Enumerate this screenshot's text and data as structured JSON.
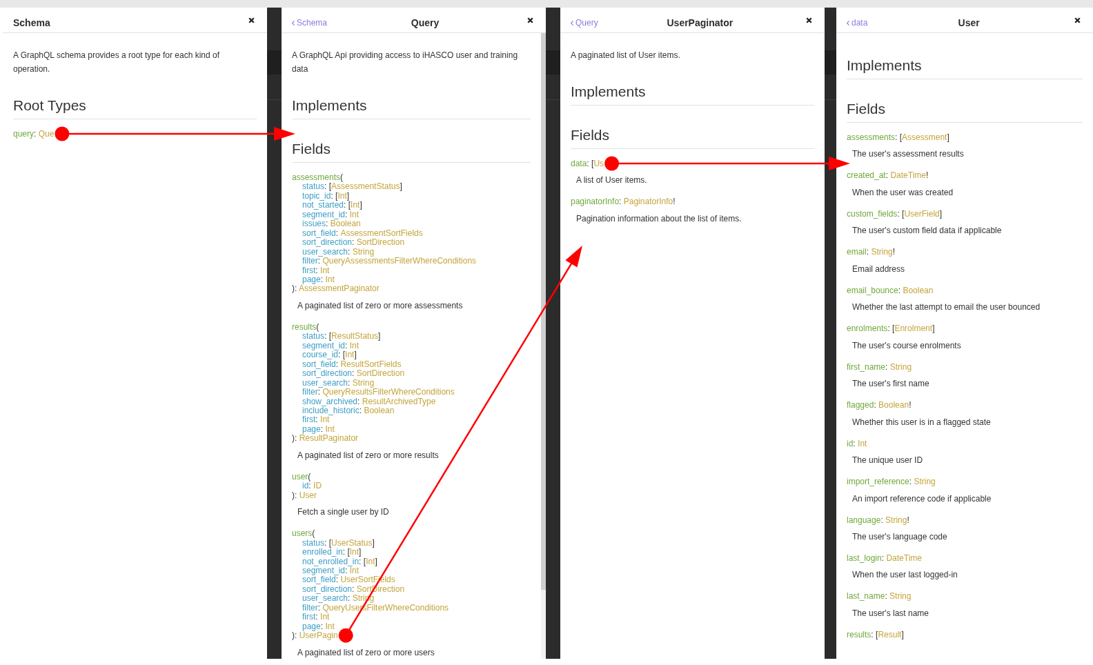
{
  "panels": [
    {
      "title": "Schema",
      "description": "A GraphQL schema provides a root type for each kind of operation.",
      "scrollbar": false,
      "sections": [
        {
          "heading": "Root Types",
          "fields": [
            {
              "name": "query:",
              "type": "Que",
              "arrow": true
            }
          ]
        }
      ]
    },
    {
      "back": "Schema",
      "title": "Query",
      "description": "A GraphQL Api providing access to iHASCO user and training data",
      "scrollbar": true,
      "sections": [
        {
          "heading": "Implements"
        },
        {
          "heading": "Fields",
          "fields": [
            {
              "name": "assessments(",
              "args": [
                {
                  "name": "status:",
                  "type": "[AssessmentStatus]"
                },
                {
                  "name": "topic_id:",
                  "type": "[Int]"
                },
                {
                  "name": "not_started:",
                  "type": "[Int]"
                },
                {
                  "name": "segment_id:",
                  "type": "Int"
                },
                {
                  "name": "issues:",
                  "type": "Boolean"
                },
                {
                  "name": "sort_field:",
                  "type": "AssessmentSortFields"
                },
                {
                  "name": "sort_direction:",
                  "type": "SortDirection"
                },
                {
                  "name": "user_search:",
                  "type": "String"
                },
                {
                  "name": "filter:",
                  "type": "QueryAssessmentsFilterWhereConditions"
                },
                {
                  "name": "first:",
                  "type": "Int"
                },
                {
                  "name": "page:",
                  "type": "Int"
                }
              ],
              "returns": "): AssessmentPaginator",
              "description": "A paginated list of zero or more assessments",
              "arrow": false
            },
            {
              "name": "results(",
              "args": [
                {
                  "name": "status:",
                  "type": "[ResultStatus]"
                },
                {
                  "name": "segment_id:",
                  "type": "Int"
                },
                {
                  "name": "course_id:",
                  "type": "[Int]"
                },
                {
                  "name": "sort_field:",
                  "type": "ResultSortFields"
                },
                {
                  "name": "sort_direction:",
                  "type": "SortDirection"
                },
                {
                  "name": "user_search:",
                  "type": "String"
                },
                {
                  "name": "filter:",
                  "type": "QueryResultsFilterWhereConditions"
                },
                {
                  "name": "show_archived:",
                  "type": "ResultArchivedType"
                },
                {
                  "name": "include_historic:",
                  "type": "Boolean"
                },
                {
                  "name": "first:",
                  "type": "Int"
                },
                {
                  "name": "page:",
                  "type": "Int"
                }
              ],
              "returns": "): ResultPaginator",
              "description": "A paginated list of zero or more results",
              "arrow": false
            },
            {
              "name": "user(",
              "args": [
                {
                  "name": "id:",
                  "type": "ID"
                }
              ],
              "returns": "): User",
              "description": "Fetch a single user by ID",
              "arrow": false
            },
            {
              "name": "users(",
              "args": [
                {
                  "name": "status:",
                  "type": "[UserStatus]"
                },
                {
                  "name": "enrolled_in:",
                  "type": "[Int]"
                },
                {
                  "name": "not_enrolled_in:",
                  "type": "[Int]"
                },
                {
                  "name": "segment_id:",
                  "type": "Int"
                },
                {
                  "name": "sort_field:",
                  "type": "UserSortFields"
                },
                {
                  "name": "sort_direction:",
                  "type": "SortDirection"
                },
                {
                  "name": "user_search:",
                  "type": "String"
                },
                {
                  "name": "filter:",
                  "type": "QueryUsersFilterWhereConditions"
                },
                {
                  "name": "first:",
                  "type": "Int"
                },
                {
                  "name": "page:",
                  "type": "Int"
                }
              ],
              "returns": "): UserPagin",
              "description": "A paginated list of zero or more users",
              "arrow": true
            }
          ]
        }
      ]
    },
    {
      "back": "Query",
      "title": "UserPaginator",
      "description": "A paginated list of User items.",
      "scrollbar": false,
      "sections": [
        {
          "heading": "Implements"
        },
        {
          "heading": "Fields",
          "fields": [
            {
              "name": "data:",
              "type": "[Us",
              "description": "A list of User items.",
              "arrow": true
            },
            {
              "name": "paginatorInfo:",
              "type": "PaginatorInfo!",
              "description": "Pagination information about the list of items.",
              "arrow": false
            }
          ]
        }
      ]
    },
    {
      "back": "data",
      "title": "User",
      "scrollbar": false,
      "sections": [
        {
          "heading": "Implements"
        },
        {
          "heading": "Fields",
          "fields": [
            {
              "name": "assessments:",
              "type": "[Assessment]",
              "description": "The user's assessment results",
              "arrow": false
            },
            {
              "name": "created_at:",
              "type": "DateTime!",
              "description": "When the user was created",
              "arrow": false
            },
            {
              "name": "custom_fields:",
              "type": "[UserField]",
              "description": "The user's custom field data if applicable",
              "arrow": false
            },
            {
              "name": "email:",
              "type": "String!",
              "description": "Email address",
              "arrow": false
            },
            {
              "name": "email_bounce:",
              "type": "Boolean",
              "description": "Whether the last attempt to email the user bounced",
              "arrow": false
            },
            {
              "name": "enrolments:",
              "type": "[Enrolment]",
              "description": "The user's course enrolments",
              "arrow": false
            },
            {
              "name": "first_name:",
              "type": "String",
              "description": "The user's first name",
              "arrow": false
            },
            {
              "name": "flagged:",
              "type": "Boolean!",
              "description": "Whether this user is in a flagged state",
              "arrow": false
            },
            {
              "name": "id:",
              "type": "Int",
              "description": "The unique user ID",
              "arrow": false
            },
            {
              "name": "import_reference:",
              "type": "String",
              "description": "An import reference code if applicable",
              "arrow": false
            },
            {
              "name": "language:",
              "type": "String!",
              "description": "The user's language code",
              "arrow": false
            },
            {
              "name": "last_login:",
              "type": "DateTime",
              "description": "When the user last logged-in",
              "arrow": false
            },
            {
              "name": "last_name:",
              "type": "String",
              "description": "The user's last name",
              "arrow": false
            },
            {
              "name": "results:",
              "type": "[Result]",
              "arrow": false
            }
          ]
        }
      ]
    }
  ]
}
